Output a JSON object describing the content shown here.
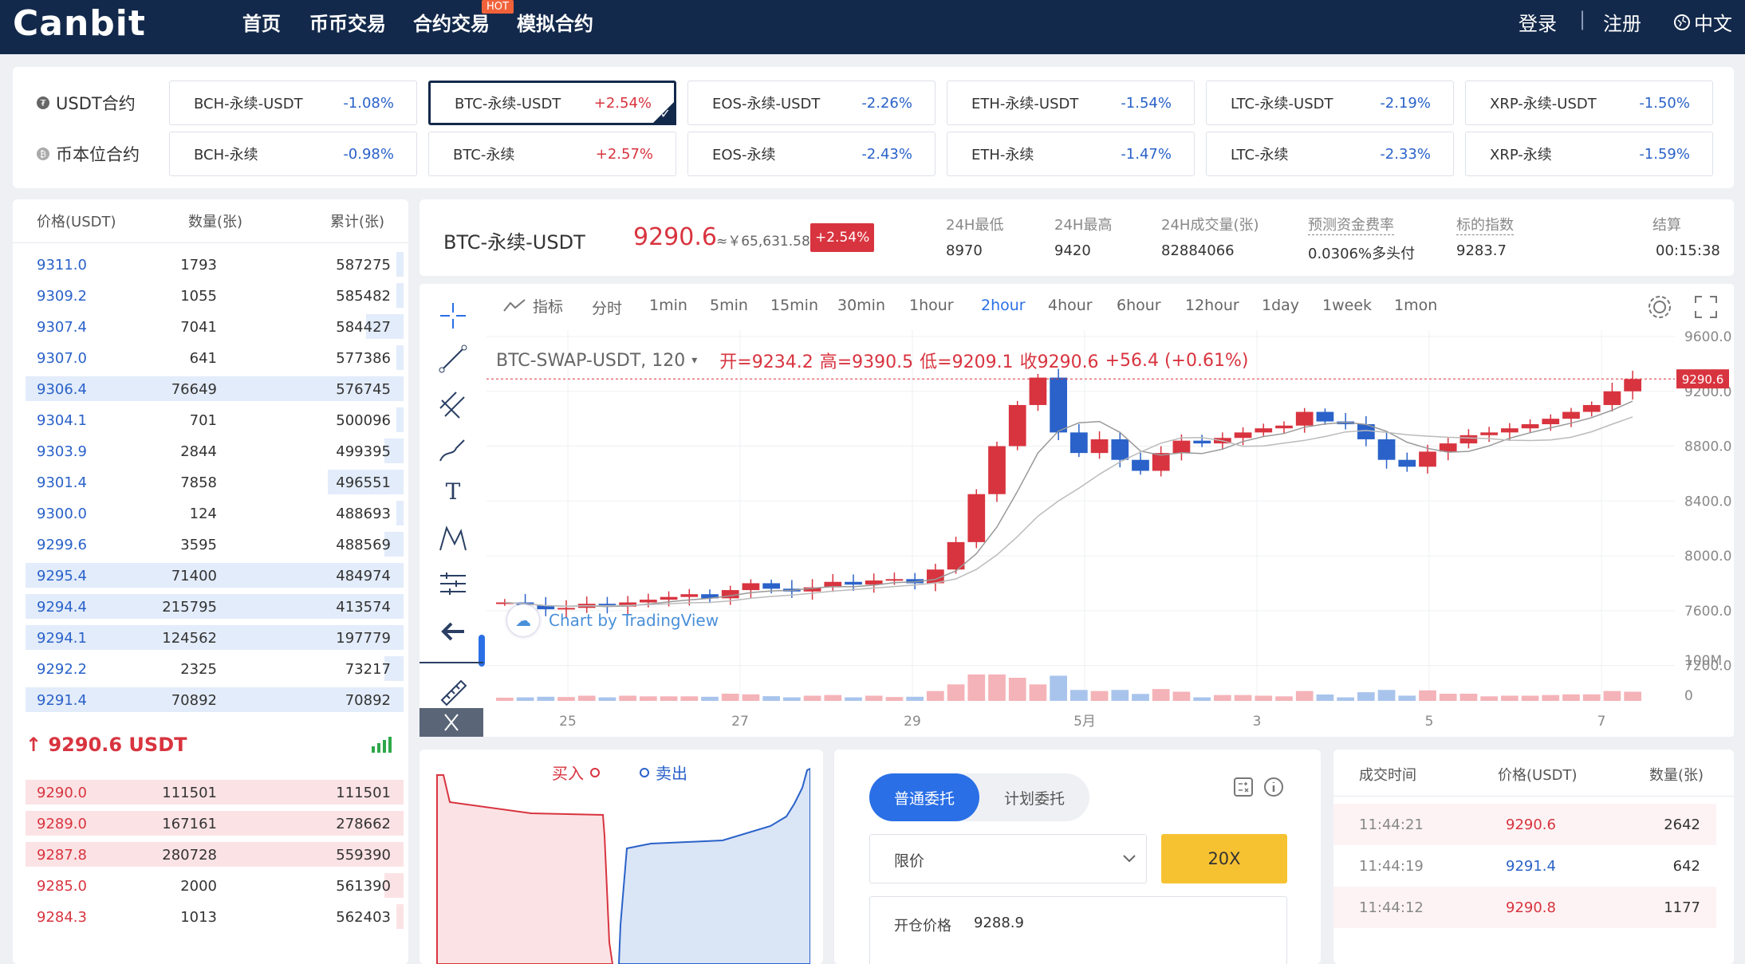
{
  "nav": {
    "logo": "Canbit",
    "items": [
      "首页",
      "币币交易",
      "合约交易",
      "模拟合约"
    ],
    "hot": "HOT",
    "login": "登录",
    "sep": "|",
    "register": "注册",
    "lang": "中文"
  },
  "tickers": {
    "row1_label": "USDT合约",
    "row2_label": "币本位合约",
    "row1": [
      {
        "name": "BCH-永续-USDT",
        "chg": "-1.08%",
        "up": false
      },
      {
        "name": "BTC-永续-USDT",
        "chg": "+2.54%",
        "up": true
      },
      {
        "name": "EOS-永续-USDT",
        "chg": "-2.26%",
        "up": false
      },
      {
        "name": "ETH-永续-USDT",
        "chg": "-1.54%",
        "up": false
      },
      {
        "name": "LTC-永续-USDT",
        "chg": "-2.19%",
        "up": false
      },
      {
        "name": "XRP-永续-USDT",
        "chg": "-1.50%",
        "up": false
      }
    ],
    "row2": [
      {
        "name": "BCH-永续",
        "chg": "-0.98%",
        "up": false
      },
      {
        "name": "BTC-永续",
        "chg": "+2.57%",
        "up": true
      },
      {
        "name": "EOS-永续",
        "chg": "-2.43%",
        "up": false
      },
      {
        "name": "ETH-永续",
        "chg": "-1.47%",
        "up": false
      },
      {
        "name": "LTC-永续",
        "chg": "-2.33%",
        "up": false
      },
      {
        "name": "XRP-永续",
        "chg": "-1.59%",
        "up": false
      }
    ]
  },
  "orderbook": {
    "headers": [
      "价格(USDT)",
      "数量(张)",
      "累计(张)"
    ],
    "asks": [
      [
        "9311.0",
        "1793",
        "587275",
        0.02
      ],
      [
        "9309.2",
        "1055",
        "585482",
        0.02
      ],
      [
        "9307.4",
        "7041",
        "584427",
        0.1
      ],
      [
        "9307.0",
        "641",
        "577386",
        0.02
      ],
      [
        "9306.4",
        "76649",
        "576745",
        1.0
      ],
      [
        "9304.1",
        "701",
        "500096",
        0.02
      ],
      [
        "9303.9",
        "2844",
        "499395",
        0.05
      ],
      [
        "9301.4",
        "7858",
        "496551",
        0.2
      ],
      [
        "9300.0",
        "124",
        "488693",
        0.02
      ],
      [
        "9299.6",
        "3595",
        "488569",
        0.05
      ],
      [
        "9295.4",
        "71400",
        "484974",
        1.0
      ],
      [
        "9294.4",
        "215795",
        "413574",
        1.0
      ],
      [
        "9294.1",
        "124562",
        "197779",
        1.0
      ],
      [
        "9292.2",
        "2325",
        "73217",
        0.05
      ],
      [
        "9291.4",
        "70892",
        "70892",
        1.0
      ]
    ],
    "last_price": "↑ 9290.6 USDT",
    "bids": [
      [
        "9290.0",
        "111501",
        "111501",
        1.0
      ],
      [
        "9289.0",
        "167161",
        "278662",
        1.0
      ],
      [
        "9287.8",
        "280728",
        "559390",
        1.0
      ],
      [
        "9285.0",
        "2000",
        "561390",
        0.05
      ],
      [
        "9284.3",
        "1013",
        "562403",
        0.02
      ]
    ]
  },
  "header": {
    "symbol": "BTC-永续-USDT",
    "price": "9290.6",
    "cny": "≈￥65,631.58",
    "change": "+2.54%",
    "stats": [
      {
        "label": "24H最低",
        "value": "8970"
      },
      {
        "label": "24H最高",
        "value": "9420"
      },
      {
        "label": "24H成交量(张)",
        "value": "82884066"
      },
      {
        "label": "预测资金费率",
        "value": "0.0306%多头付"
      },
      {
        "label": "标的指数",
        "value": "9283.7"
      },
      {
        "label": "结算",
        "value": "00:15:38"
      }
    ]
  },
  "chart": {
    "indicator": "指标",
    "timeframes": [
      "分时",
      "1min",
      "5min",
      "15min",
      "30min",
      "1hour",
      "2hour",
      "4hour",
      "6hour",
      "12hour",
      "1day",
      "1week",
      "1mon"
    ],
    "active": "2hour",
    "legend": {
      "symbol": "BTC-SWAP-USDT, 120",
      "o_label": "开=",
      "o": "9234.2",
      "h_label": "高=",
      "h": "9390.5",
      "l_label": "低=",
      "l": "9209.1",
      "c_label": "收",
      "c": "9290.6",
      "chg": "+56.4 (+0.61%)"
    },
    "watermark": "Chart by TradingView",
    "price_tag": "9290.6",
    "y_ticks": [
      "9600.0",
      "9200.0",
      "8800.0",
      "8400.0",
      "8000.0",
      "7600.0",
      "7200.0"
    ],
    "vol_ticks": [
      "100M",
      "0"
    ],
    "x_ticks": [
      "25",
      "27",
      "29",
      "5月",
      "3",
      "5",
      "7"
    ]
  },
  "chart_data": {
    "type": "candlestick",
    "title": "BTC-SWAP-USDT, 120",
    "ylim": [
      7000,
      9600
    ],
    "x": [
      "25",
      "27",
      "29",
      "5月",
      "3",
      "5",
      "7"
    ],
    "close": [
      7660,
      7640,
      7610,
      7620,
      7650,
      7630,
      7660,
      7680,
      7700,
      7720,
      7690,
      7750,
      7800,
      7760,
      7740,
      7770,
      7810,
      7790,
      7820,
      7830,
      7800,
      7900,
      8100,
      8450,
      8800,
      9100,
      9300,
      8900,
      8750,
      8850,
      8700,
      8620,
      8750,
      8840,
      8820,
      8860,
      8900,
      8930,
      8950,
      9050,
      8980,
      8960,
      8850,
      8700,
      8650,
      8760,
      8820,
      8880,
      8900,
      8930,
      8960,
      9000,
      9050,
      9100,
      9200,
      9290
    ]
  },
  "depth": {
    "buy": "买入",
    "sell": "卖出"
  },
  "order": {
    "tab1": "普通委托",
    "tab2": "计划委托",
    "type": "限价",
    "leverage": "20X",
    "price_label": "开仓价格",
    "price": "9288.9"
  },
  "trades": {
    "headers": [
      "成交时间",
      "价格(USDT)",
      "数量(张)"
    ],
    "rows": [
      [
        "11:44:21",
        "9290.6",
        "2642",
        true
      ],
      [
        "11:44:19",
        "9291.4",
        "642",
        false
      ],
      [
        "11:44:12",
        "9290.8",
        "1177",
        true
      ]
    ]
  },
  "colors": {
    "navy": "#13294b",
    "up": "#d8343f",
    "down": "#2a62c9",
    "accent": "#2a6fe6",
    "yellow": "#f7c232"
  }
}
